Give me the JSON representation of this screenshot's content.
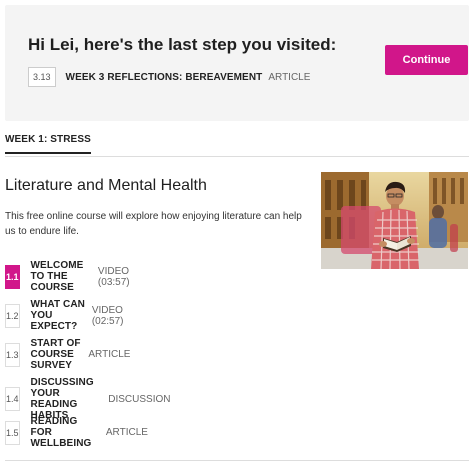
{
  "resume": {
    "greeting": "Hi Lei, here's the last step you visited:",
    "step_number": "3.13",
    "step_title": "WEEK 3 REFLECTIONS: BEREAVEMENT",
    "step_type": "ARTICLE",
    "continue_label": "Continue"
  },
  "week_tab": {
    "label": "WEEK 1: STRESS"
  },
  "course": {
    "title": "Literature and Mental Health",
    "description": "This free online course will explore how enjoying literature can help us to endure life."
  },
  "steps": [
    {
      "number": "1.1",
      "title": "WELCOME TO THE COURSE",
      "type": "VIDEO (03:57)",
      "active": true
    },
    {
      "number": "1.2",
      "title": "WHAT CAN YOU EXPECT?",
      "type": "VIDEO (02:57)",
      "active": false
    },
    {
      "number": "1.3",
      "title": "START OF COURSE SURVEY",
      "type": "ARTICLE",
      "active": false
    },
    {
      "number": "1.4",
      "title": "DISCUSSING YOUR READING HABITS",
      "type": "DISCUSSION",
      "active": false
    },
    {
      "number": "1.5",
      "title": "READING FOR WELLBEING",
      "type": "ARTICLE",
      "active": false
    }
  ],
  "colors": {
    "accent": "#d1168a",
    "panel_bg": "#f4f4f4"
  },
  "hero_image": {
    "subject": "man-reading-book-icon"
  }
}
